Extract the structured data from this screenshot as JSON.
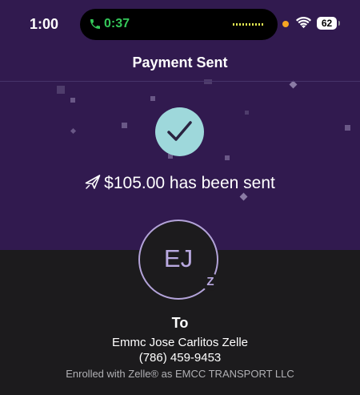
{
  "status_bar": {
    "time": "1:00",
    "call_timer": "0:37",
    "battery": "62",
    "phone_icon": "phone-icon",
    "wifi_icon": "wifi-icon"
  },
  "header": {
    "title": "Payment Sent"
  },
  "confirmation": {
    "icon": "checkmark-icon",
    "plane_icon": "paper-plane-icon",
    "amount_text": "$105.00 has been sent"
  },
  "recipient": {
    "initials": "EJ",
    "badge": "Z",
    "to_label": "To",
    "name": "Emmc Jose Carlitos Zelle",
    "phone": "(786) 459-9453",
    "enrolled": "Enrolled with Zelle® as EMCC TRANSPORT LLC"
  },
  "colors": {
    "header_background": "#311a4f",
    "body_background": "#1c1b1d",
    "check_circle": "#9ed8db",
    "avatar_accent": "#b9a9e0",
    "call_green": "#34c759"
  }
}
